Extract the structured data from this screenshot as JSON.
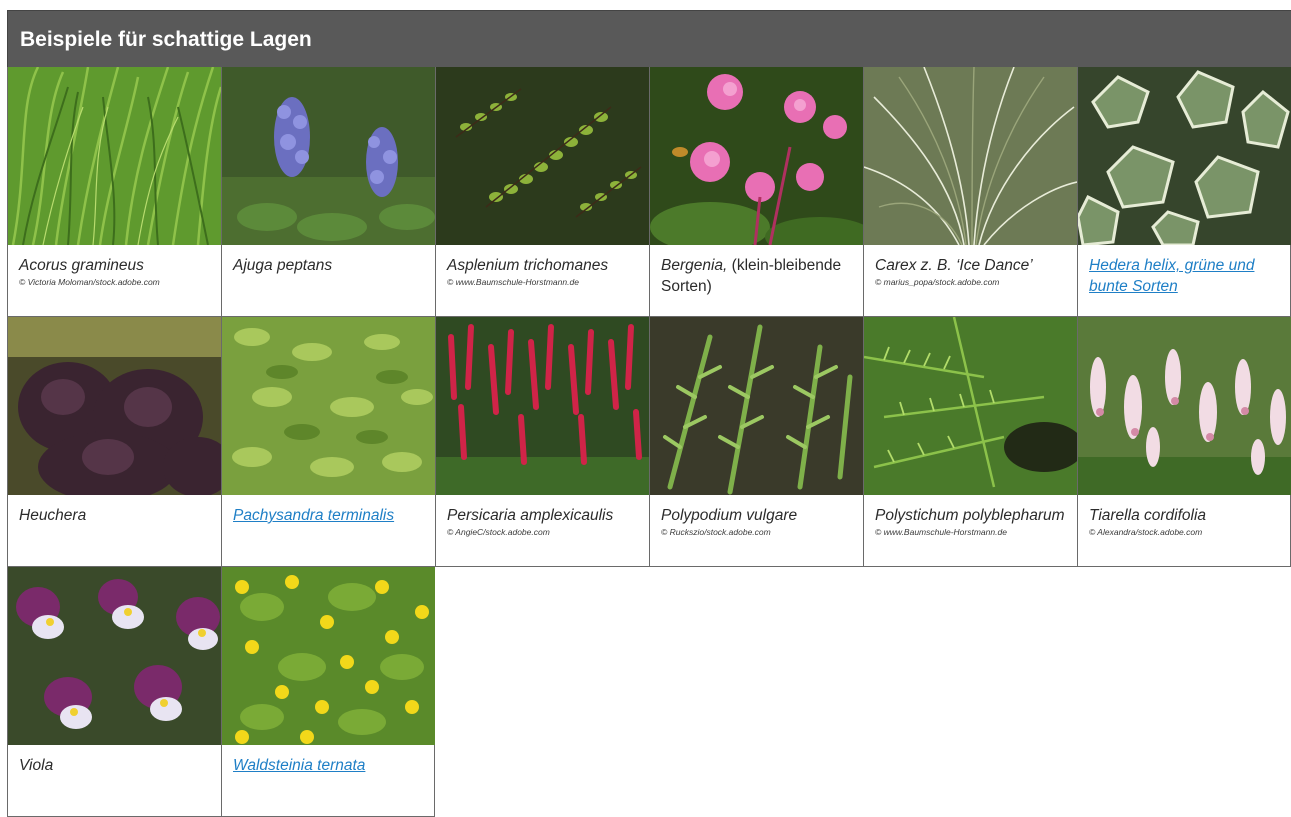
{
  "header": {
    "title": "Beispiele für schattige Lagen"
  },
  "colors": {
    "header_bg": "#595959",
    "link": "#1f7fc6",
    "border": "#6a6a6a"
  },
  "plants": [
    {
      "name": "Acorus gramineus",
      "credit": "© Victoria Moloman/stock.adobe.com",
      "link": false
    },
    {
      "name": "Ajuga peptans",
      "credit": "",
      "link": false
    },
    {
      "name": "Asplenium trichomanes",
      "credit": "© www.Baumschule-Horstmann.de",
      "link": false
    },
    {
      "name_italic": "Bergenia,",
      "name_rest": " (klein-bleibende Sorten)",
      "credit": "",
      "link": false
    },
    {
      "name": "Carex z. B. ‘Ice Dance’",
      "credit": "© marius_popa/stock.adobe.com",
      "link": false
    },
    {
      "name": "Hedera helix, grüne und bunte Sorten",
      "credit": "",
      "link": true
    },
    {
      "name": "Heuchera",
      "credit": "",
      "link": false
    },
    {
      "name": "Pachysandra terminalis",
      "credit": "",
      "link": true
    },
    {
      "name": "Persicaria amplexicaulis",
      "credit": "© AngieC/stock.adobe.com",
      "link": false
    },
    {
      "name": "Polypodium vulgare",
      "credit": "© Ruckszio/stock.adobe.com",
      "link": false
    },
    {
      "name": "Polystichum polyblepharum",
      "credit": "© www.Baumschule-Horstmann.de",
      "link": false
    },
    {
      "name": "Tiarella cordifolia",
      "credit": "© Alexandra/stock.adobe.com",
      "link": false
    },
    {
      "name": "Viola",
      "credit": "",
      "link": false
    },
    {
      "name": "Waldsteinia ternata",
      "credit": "",
      "link": true
    }
  ]
}
